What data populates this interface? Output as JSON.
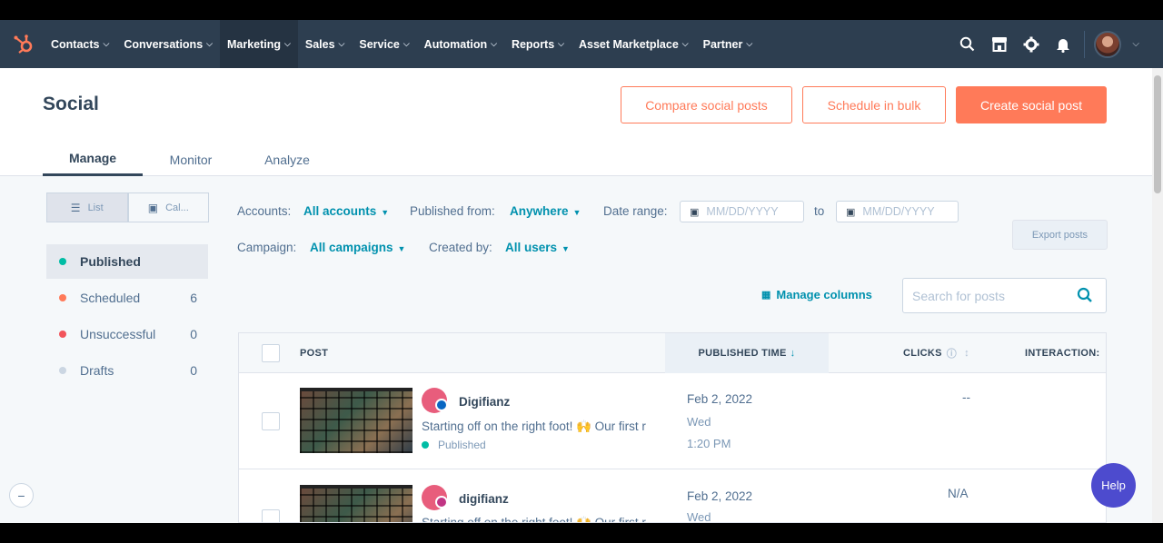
{
  "nav": {
    "items": [
      {
        "label": "Contacts"
      },
      {
        "label": "Conversations"
      },
      {
        "label": "Marketing"
      },
      {
        "label": "Sales"
      },
      {
        "label": "Service"
      },
      {
        "label": "Automation"
      },
      {
        "label": "Reports"
      },
      {
        "label": "Asset Marketplace"
      },
      {
        "label": "Partner"
      }
    ],
    "active": "Marketing",
    "icons": [
      "search-icon",
      "marketplace-icon",
      "settings-icon",
      "notifications-icon"
    ]
  },
  "header": {
    "title": "Social",
    "compare_label": "Compare social posts",
    "bulk_label": "Schedule in bulk",
    "create_label": "Create social post",
    "tabs": [
      {
        "label": "Manage"
      },
      {
        "label": "Monitor"
      },
      {
        "label": "Analyze"
      }
    ]
  },
  "sidebar": {
    "view_list": "List",
    "view_calendar": "Cal...",
    "filters": [
      {
        "label": "Published",
        "count": "",
        "color": "#00bda5"
      },
      {
        "label": "Scheduled",
        "count": "6",
        "color": "#ff7a59"
      },
      {
        "label": "Unsuccessful",
        "count": "0",
        "color": "#f2545b"
      },
      {
        "label": "Drafts",
        "count": "0",
        "color": "#cbd6e2"
      }
    ]
  },
  "filters": {
    "accounts_label": "Accounts:",
    "accounts_value": "All accounts",
    "published_from_label": "Published from:",
    "published_from_value": "Anywhere",
    "date_range_label": "Date range:",
    "date_placeholder": "MM/DD/YYYY",
    "to_label": "to",
    "campaign_label": "Campaign:",
    "campaign_value": "All campaigns",
    "created_by_label": "Created by:",
    "created_by_value": "All users",
    "export_label": "Export posts",
    "manage_columns_label": "Manage columns",
    "search_placeholder": "Search for posts"
  },
  "table": {
    "columns": {
      "post": "POST",
      "published_time": "PUBLISHED TIME",
      "clicks": "CLICKS",
      "interactions": "INTERACTION:"
    },
    "rows": [
      {
        "account": "Digifianz",
        "text": "Starting off on the right foot! 🙌 Our first r",
        "status": "Published",
        "date": "Feb 2, 2022",
        "day": "Wed",
        "time": "1:20 PM",
        "clicks": "--",
        "network_color": "#0a66c2"
      },
      {
        "account": "digifianz",
        "text": "Starting off on the right foot! 🙌 Our first r",
        "status": "",
        "date": "Feb 2, 2022",
        "day": "Wed",
        "time": "",
        "clicks": "N/A",
        "network_color": "#c13584"
      }
    ]
  },
  "help_label": "Help",
  "colors": {
    "nav_bg": "#2d3e50",
    "accent": "#ff7a59",
    "link": "#0091ae"
  }
}
